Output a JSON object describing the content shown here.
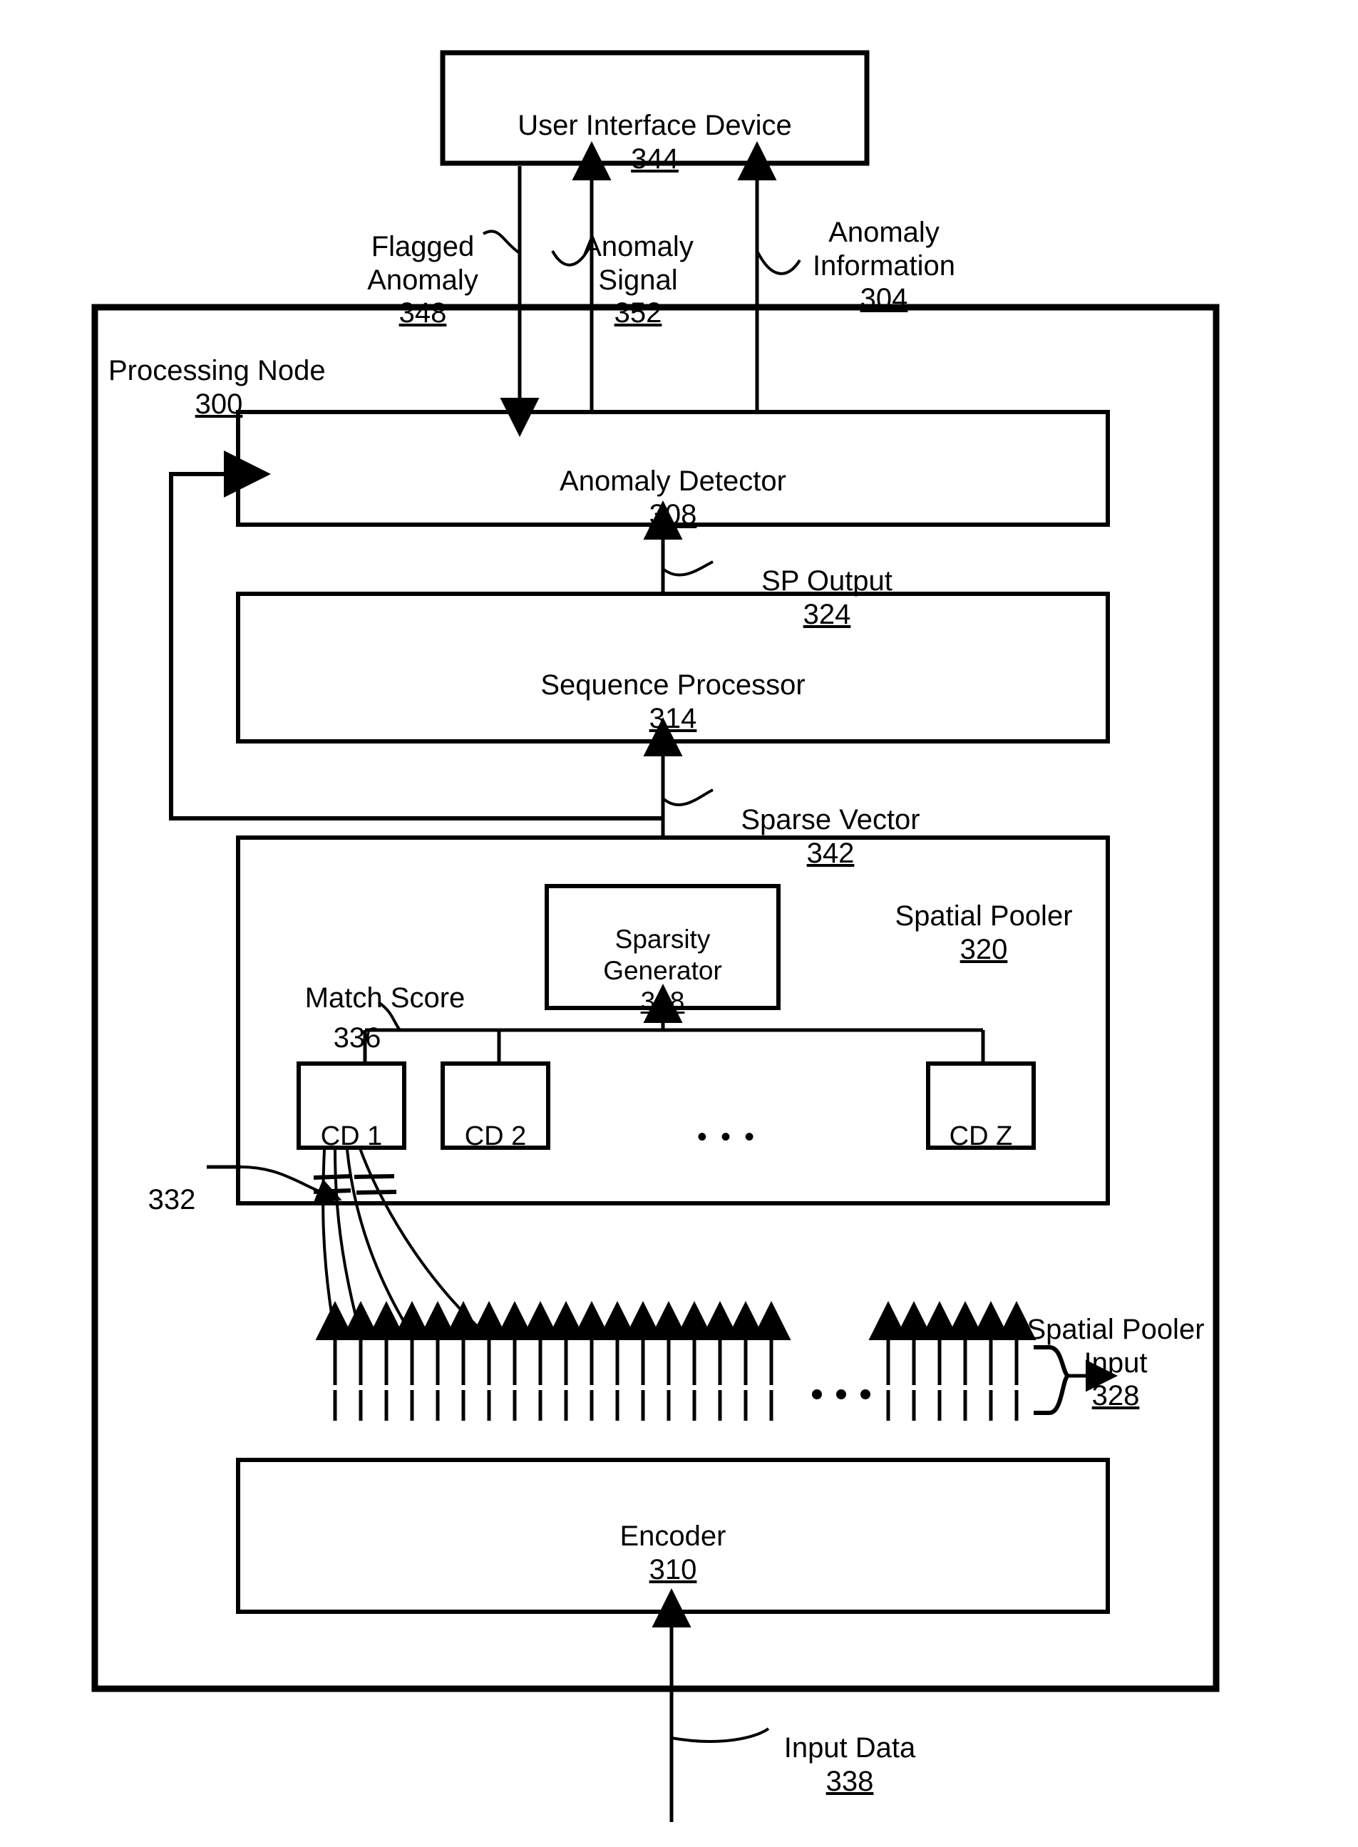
{
  "figure": {
    "type": "block-diagram",
    "title": "Processing Node block diagram",
    "background": "#ffffff",
    "stroke": "#000000"
  },
  "blocks": {
    "user_interface_device": {
      "name": "User Interface Device",
      "ref": "344"
    },
    "processing_node": {
      "name": "Processing Node",
      "ref": "300"
    },
    "anomaly_detector": {
      "name": "Anomaly Detector",
      "ref": "308"
    },
    "sequence_processor": {
      "name": "Sequence Processor",
      "ref": "314"
    },
    "spatial_pooler": {
      "name": "Spatial Pooler",
      "ref": "320"
    },
    "sparsity_generator": {
      "name": "Sparsity\nGenerator",
      "ref": "318"
    },
    "encoder": {
      "name": "Encoder",
      "ref": "310"
    }
  },
  "cd_cells": [
    {
      "label": "CD 1"
    },
    {
      "label": "CD 2"
    },
    {
      "label": "CD Z"
    }
  ],
  "cd_ellipsis": "• • •",
  "signals": {
    "flagged_anomaly": {
      "name": "Flagged\nAnomaly",
      "ref": "348",
      "direction": "down"
    },
    "anomaly_signal": {
      "name": "Anomaly\nSignal",
      "ref": "352",
      "direction": "up"
    },
    "anomaly_information": {
      "name": "Anomaly\nInformation",
      "ref": "304",
      "direction": "up"
    },
    "sp_output": {
      "name": "SP Output",
      "ref": "324",
      "direction": "up"
    },
    "sparse_vector": {
      "name": "Sparse Vector",
      "ref": "342",
      "direction": "up"
    },
    "match_score": {
      "name": "Match Score",
      "ref": "336",
      "direction": "up"
    },
    "spatial_pooler_input": {
      "name": "Spatial Pooler\nInput",
      "ref": "328",
      "direction": "up"
    },
    "input_data": {
      "name": "Input Data",
      "ref": "338",
      "direction": "up"
    },
    "synapses": {
      "name": "",
      "ref": "332",
      "direction": "none"
    }
  },
  "input_arrows": {
    "left_group_count": 18,
    "right_group_count": 6,
    "ellipsis": "• • •"
  }
}
